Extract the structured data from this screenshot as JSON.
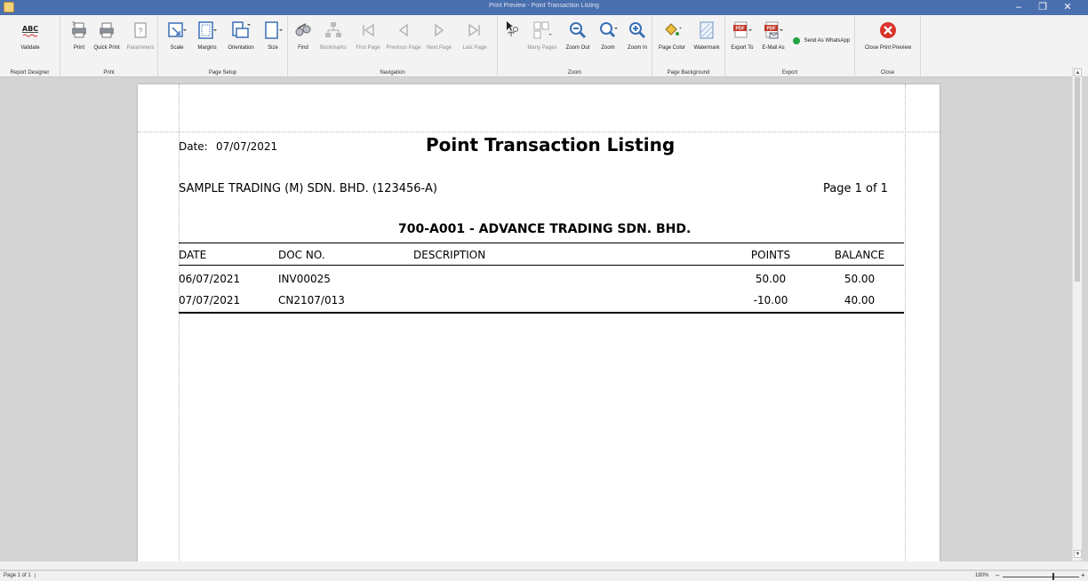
{
  "window": {
    "title": "Print Preview - Point Transaction Listing",
    "minimize": "–",
    "restore": "❐",
    "close": "✕"
  },
  "ribbon": {
    "groups": {
      "report_designer": "Report Designer",
      "print": "Print",
      "page_setup": "Page Setup",
      "navigation": "Navigation",
      "zoom": "Zoom",
      "page_background": "Page Background",
      "export": "Export",
      "close": "Close"
    },
    "buttons": {
      "validate": "Validate",
      "validate_icon_text": "ABC",
      "print": "Print",
      "quick_print": "Quick Print",
      "parameters": "Parameters",
      "scale": "Scale",
      "margins": "Margins",
      "orientation": "Orientation",
      "size": "Size",
      "find": "Find",
      "bookmarks": "Bookmarks",
      "first_page": "First Page",
      "previous_page": "Previous Page",
      "next_page": "Next Page",
      "last_page": "Last Page",
      "many_pages": "Many Pages",
      "zoom_out": "Zoom Out",
      "zoom": "Zoom",
      "zoom_in": "Zoom In",
      "page_color": "Page Color",
      "watermark": "Watermark",
      "export_to": "Export To",
      "email_as": "E-Mail As",
      "send_whatsapp": "Send As WhatsApp",
      "close_preview": "Close Print Preview"
    }
  },
  "report": {
    "date_label": "Date:",
    "date_value": "07/07/2021",
    "title": "Point Transaction Listing",
    "company": "SAMPLE TRADING (M) SDN. BHD. (123456-A)",
    "page_info": "Page 1 of 1",
    "customer": "700-A001 - ADVANCE TRADING SDN. BHD.",
    "columns": {
      "date": "DATE",
      "doc_no": "DOC NO.",
      "description": "DESCRIPTION",
      "points": "POINTS",
      "balance": "BALANCE"
    },
    "rows": [
      {
        "date": "06/07/2021",
        "doc_no": "INV00025",
        "description": "",
        "points": "50.00",
        "balance": "50.00"
      },
      {
        "date": "07/07/2021",
        "doc_no": "CN2107/013",
        "description": "",
        "points": "-10.00",
        "balance": "40.00"
      }
    ]
  },
  "status": {
    "page": "Page 1 of 1",
    "zoom": "180%",
    "zoom_minus": "–",
    "zoom_plus": "+"
  },
  "colors": {
    "titlebar": "#4a6fae",
    "ribbon": "#f3f3f3",
    "workspace": "#d4d4d4",
    "close_red": "#d9332b",
    "pdf_red": "#c0392b",
    "whatsapp_green": "#25a244"
  }
}
